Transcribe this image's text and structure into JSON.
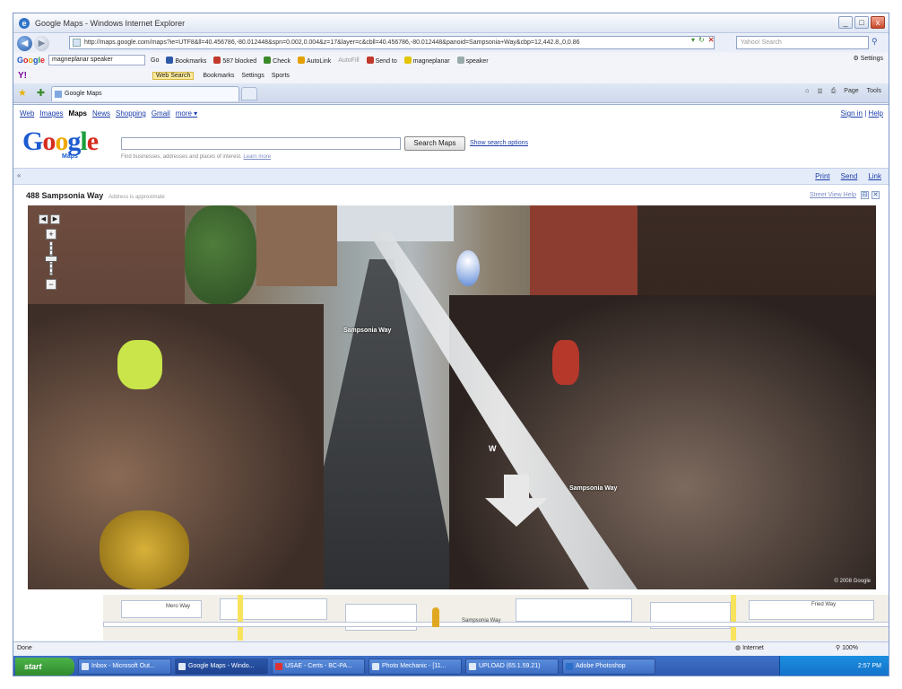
{
  "window": {
    "title": "Google Maps - Windows Internet Explorer",
    "buttons": {
      "minimize": "_",
      "maximize": "□",
      "close": "x"
    }
  },
  "address_bar": {
    "url": "http://maps.google.com/maps?ie=UTF8&ll=40.456786,-80.012448&spn=0.002,0.004&z=17&layer=c&cbll=40.456786,-80.012448&panoid=Sampsonia+Way&cbp=12,442.8,,0,0.86",
    "search_placeholder": "Yahoo! Search"
  },
  "google_toolbar": {
    "logo": [
      "G",
      "o",
      "o",
      "g",
      "l",
      "e"
    ],
    "search_value": "magneplanar speaker",
    "go_label": "Go",
    "items": [
      "Bookmarks",
      "587 blocked",
      "Check",
      "AutoLink",
      "AutoFill",
      "Send to",
      "magneplanar",
      "speaker"
    ],
    "settings_label": "Settings"
  },
  "yahoo_toolbar": {
    "logo": "Y!",
    "web_search_label": "Web Search",
    "items": [
      "Bookmarks",
      "Settings",
      "Sports"
    ]
  },
  "tabs": {
    "active_tab_label": "Google Maps",
    "commands": [
      "Page",
      "Tools"
    ]
  },
  "google_nav": {
    "links": [
      "Web",
      "Images",
      "Maps",
      "News",
      "Shopping",
      "Gmail",
      "more ▾"
    ],
    "active_index": 2,
    "signin": "Sign in",
    "help": "Help"
  },
  "google_maps": {
    "logo": [
      "G",
      "o",
      "o",
      "g",
      "l",
      "e"
    ],
    "logo_sub": "Maps",
    "search_button": "Search Maps",
    "search_options": "Show search options",
    "hint": "Find businesses, addresses and places of interest.",
    "hint_link": "Learn more",
    "links": [
      "Print",
      "Send",
      "Link"
    ]
  },
  "street_view": {
    "address": "488 Sampsonia Way",
    "address_note": "Address is approximate",
    "help": "Street View Help",
    "street_label": "Sampsonia Way",
    "compass": "W",
    "copyright": "© 2008 Google"
  },
  "minimap": {
    "street_label": "Sampsonia Way",
    "other_label": "Mero Way",
    "third_label": "Fried Way"
  },
  "status_bar": {
    "status": "Done",
    "zone": "Internet",
    "zoom": "100%"
  },
  "taskbar": {
    "start": "start",
    "items": [
      "Inbox - Microsoft Out...",
      "Google Maps - Windo...",
      "USAE - Certs - BC-PA...",
      "Photo Mechanic - [11...",
      "UPLOAD (65.1.59.21)",
      "Adobe Photoshop"
    ],
    "active_index": 1,
    "clock": "2:57 PM"
  }
}
